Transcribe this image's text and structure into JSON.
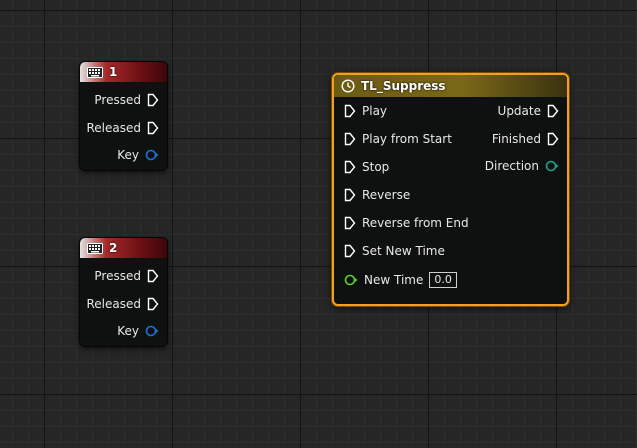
{
  "key_nodes": [
    {
      "title": "1",
      "icon": "keyboard-icon",
      "pins": {
        "pressed": "Pressed",
        "released": "Released",
        "key": "Key"
      }
    },
    {
      "title": "2",
      "icon": "keyboard-icon",
      "pins": {
        "pressed": "Pressed",
        "released": "Released",
        "key": "Key"
      }
    }
  ],
  "timeline_node": {
    "title": "TL_Suppress",
    "icon": "clock-icon",
    "inputs": [
      "Play",
      "Play from Start",
      "Stop",
      "Reverse",
      "Reverse from End",
      "Set New Time"
    ],
    "outputs": [
      "Update",
      "Finished"
    ],
    "direction_label": "Direction",
    "new_time_label": "New Time",
    "new_time_value": "0.0"
  },
  "colors": {
    "exec_pin": "#ffffff",
    "key_pin": "#1f6fe0",
    "direction_pin": "#1aa58a",
    "float_pin": "#5ed02e",
    "selection": "#f0a21a"
  }
}
